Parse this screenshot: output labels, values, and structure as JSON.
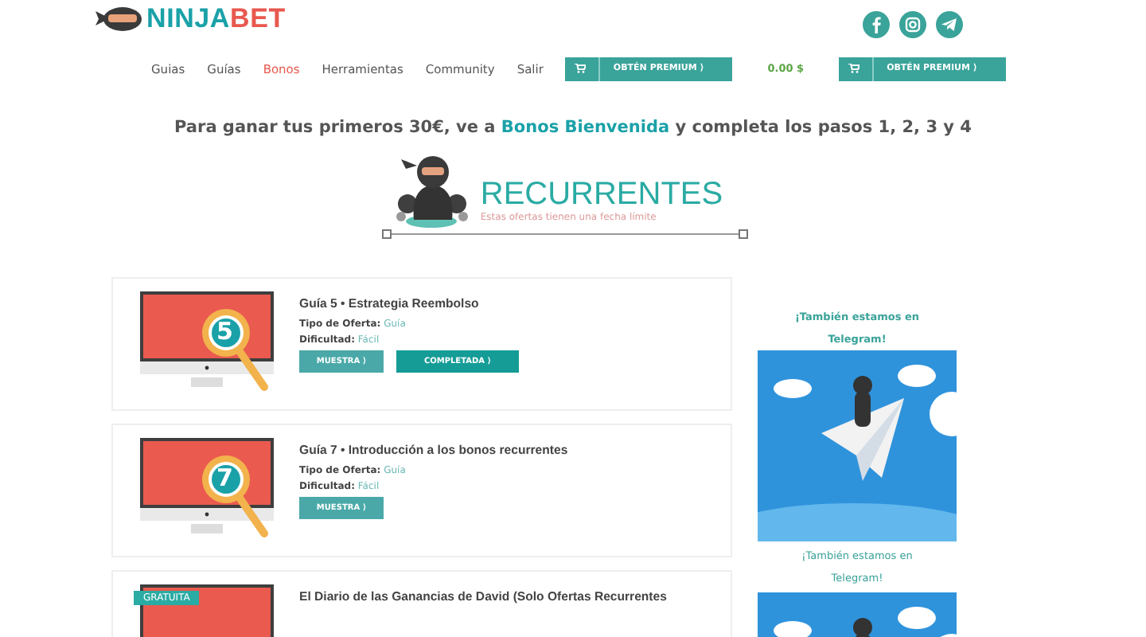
{
  "header": {
    "logo": {
      "part_1": "NINJA",
      "part_2": "BET"
    },
    "social_icons": [
      {
        "kind": "facebook"
      },
      {
        "kind": "instagram"
      },
      {
        "kind": "telegram"
      }
    ]
  },
  "nav": {
    "items": [
      {
        "label": "Guias",
        "selected": false
      },
      {
        "label": "Guías",
        "selected": false
      },
      {
        "label": "Bonos",
        "selected": true
      },
      {
        "label": "Herramientas",
        "selected": false
      },
      {
        "label": "Community",
        "selected": false
      },
      {
        "label": "Salir",
        "selected": false
      }
    ],
    "actions": [
      {
        "kind": "premium",
        "label": "OBTÉN PREMIUM ⟩"
      },
      {
        "kind": "balance",
        "label": "0.00 $"
      },
      {
        "kind": "premium",
        "label": "OBTÉN PREMIUM ⟩"
      }
    ]
  },
  "headline": {
    "before": "Para ganar tus primeros 30€, ve a",
    "link": "Bonos Bienvenida",
    "after": "y completa los pasos 1, 2, 3 y 4"
  },
  "banner": {
    "title": "RECURRENTES",
    "subtitle": "Estas ofertas tienen una fecha límite"
  },
  "cards": [
    {
      "number": "5",
      "title": "Guía 5 • Estrategia Reembolso",
      "details": [
        {
          "label": "Tipo de Oferta:",
          "value": "Guía"
        },
        {
          "label": "Dificultad:",
          "value": "Fácil"
        }
      ],
      "buttons": [
        {
          "kind": "sample",
          "label": "MUESTRA ⟩"
        },
        {
          "kind": "completed",
          "label": "COMPLETADA ⟩"
        }
      ]
    },
    {
      "number": "7",
      "title": "Guía 7 • Introducción a los bonos recurrentes",
      "details": [
        {
          "label": "Tipo de Oferta:",
          "value": "Guía"
        },
        {
          "label": "Dificultad:",
          "value": "Fácil"
        }
      ],
      "buttons": [
        {
          "kind": "sample",
          "label": "MUESTRA ⟩"
        }
      ]
    },
    {
      "ribbon": "GRATUITA",
      "title": "El Diario de las Ganancias de David (Solo Ofertas Recurrentes"
    }
  ],
  "sidebar": {
    "widgets": [
      {
        "kind": "heading",
        "text": "¡También estamos en Telegram!"
      },
      {
        "kind": "image"
      },
      {
        "kind": "caption",
        "text": "¡También estamos en Telegram!"
      },
      {
        "kind": "image"
      }
    ]
  }
}
